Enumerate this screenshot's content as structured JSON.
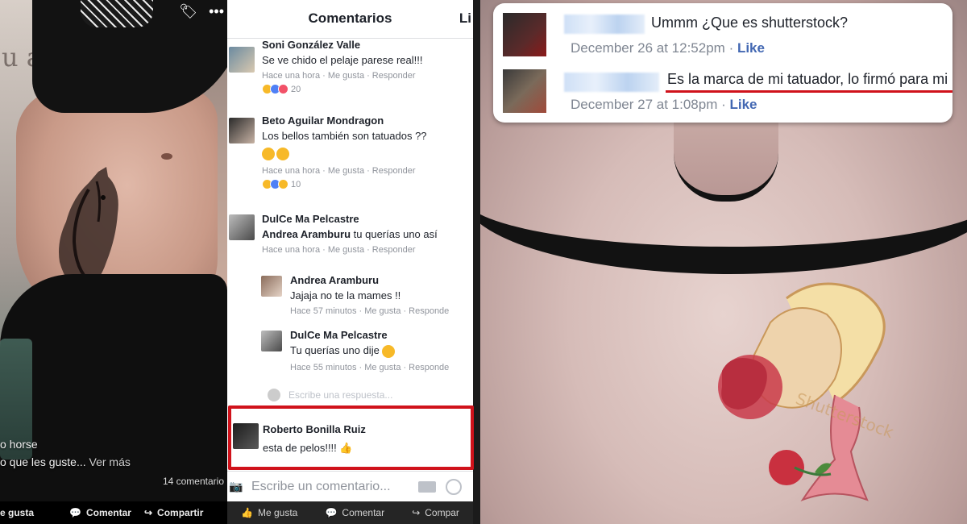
{
  "left_post": {
    "caption_line1": "o horse",
    "caption_line2": "o que les guste...",
    "see_more": "Ver más",
    "comments_count": "14 comentario",
    "actions": {
      "like": "e gusta",
      "comment": "Comentar",
      "share": "Compartir"
    },
    "bg_word": "u a"
  },
  "comments_panel": {
    "title": "Comentarios",
    "header_right": "Li",
    "comments": [
      {
        "name": "Soni González Valle",
        "text": "Se ve chido el pelaje parese real!!!",
        "meta": [
          "Hace una hora",
          "Me gusta",
          "Responder"
        ],
        "reaction_count": "20"
      },
      {
        "name": "Beto Aguilar Mondragon",
        "text": "Los bellos también son tatuados ??",
        "meta": [
          "Hace una hora",
          "Me gusta",
          "Responder"
        ],
        "reaction_count": "10"
      },
      {
        "name": "DulCe Ma Pelcastre",
        "mention": "Andrea Aramburu",
        "text": " tu querías uno así",
        "meta": [
          "Hace una hora",
          "Me gusta",
          "Responder"
        ]
      }
    ],
    "replies": [
      {
        "name": "Andrea Aramburu",
        "text": "Jajaja no te la mames !!",
        "meta": [
          "Hace 57 minutos",
          "Me gusta",
          "Responde"
        ]
      },
      {
        "name": "DulCe Ma Pelcastre",
        "text": "Tu querías uno dije",
        "meta": [
          "Hace 55 minutos",
          "Me gusta",
          "Responde"
        ]
      }
    ],
    "write_reply_placeholder": "Escribe una respuesta...",
    "highlighted_comment": {
      "name": "Roberto Bonilla Ruiz",
      "text": "esta de pelos!!!!"
    },
    "input_placeholder": "Escribe un comentario...",
    "bottom_actions": {
      "like": "Me gusta",
      "comment": "Comentar",
      "share": "Compar"
    }
  },
  "right_post": {
    "comment1": {
      "text": "Ummm ¿Que es shutterstock?",
      "date": "December 26 at 12:52pm",
      "like": "Like"
    },
    "comment2": {
      "text": "Es la marca de mi tatuador, lo firmó para mi",
      "date": "December 27 at 1:08pm",
      "like": "Like"
    },
    "tattoo_text": "Shutterstock"
  },
  "colors": {
    "facebook_blue": "#4267b2",
    "highlight_red": "#d0121b",
    "meta_gray": "#90949c"
  }
}
